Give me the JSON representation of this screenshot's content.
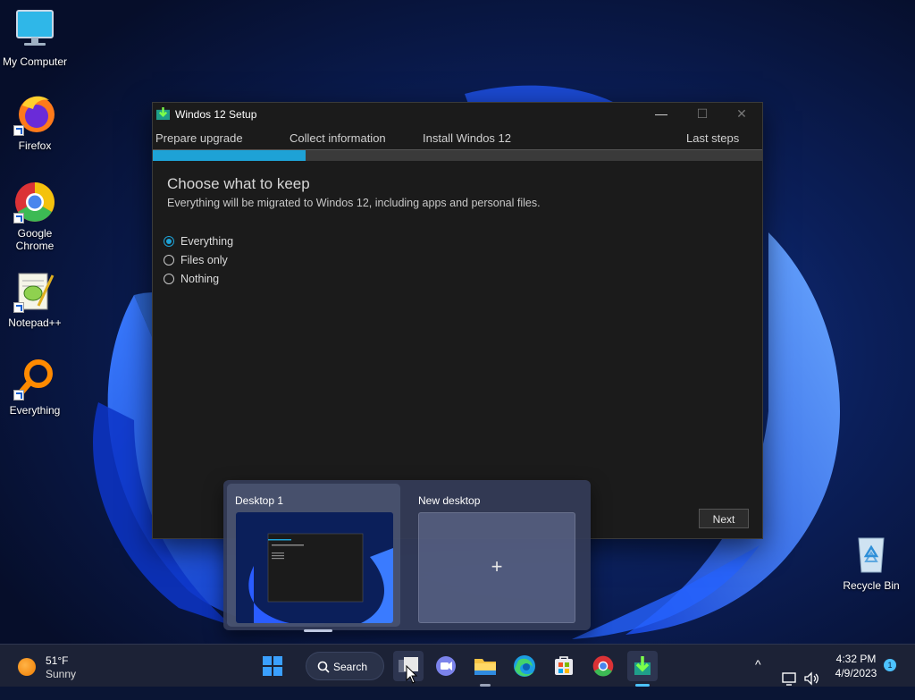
{
  "desktop": {
    "icons": [
      {
        "label": "My Computer",
        "icon": "monitor-icon"
      },
      {
        "label": "Firefox",
        "icon": "firefox-icon"
      },
      {
        "label": "Google Chrome",
        "icon": "chrome-icon"
      },
      {
        "label": "Notepad++",
        "icon": "notepadpp-icon"
      },
      {
        "label": "Everything",
        "icon": "magnifier-icon"
      },
      {
        "label": "Recycle Bin",
        "icon": "recycle-bin-icon"
      }
    ]
  },
  "window": {
    "title": "Windos 12 Setup",
    "controls": {
      "minimize": "—",
      "maximize": "☐",
      "close": "✕"
    },
    "steps": [
      "Prepare upgrade",
      "Collect information",
      "Install Windos 12",
      "Last steps"
    ],
    "progress": 0.25,
    "accent": "#1ea2d6",
    "heading": "Choose what to keep",
    "subtitle": "Everything will be migrated to Windos 12, including apps and personal files.",
    "options": [
      {
        "label": "Everything",
        "selected": true
      },
      {
        "label": "Files only",
        "selected": false
      },
      {
        "label": "Nothing",
        "selected": false
      }
    ],
    "next_label": "Next"
  },
  "task_view": {
    "desktops": [
      {
        "label": "Desktop 1",
        "active": true
      },
      {
        "label": "New desktop",
        "plus": "+"
      }
    ]
  },
  "taskbar": {
    "weather": {
      "temp": "51°F",
      "condition": "Sunny"
    },
    "search_label": "Search",
    "apps": [
      "start-icon",
      "search-icon",
      "task-view-icon",
      "teams-chat-icon",
      "file-explorer-icon",
      "edge-icon",
      "store-icon",
      "chrome-icon",
      "setup-icon"
    ],
    "tray": {
      "chevron": "^",
      "time": "4:32 PM",
      "date": "4/9/2023",
      "notifications": "1"
    }
  }
}
